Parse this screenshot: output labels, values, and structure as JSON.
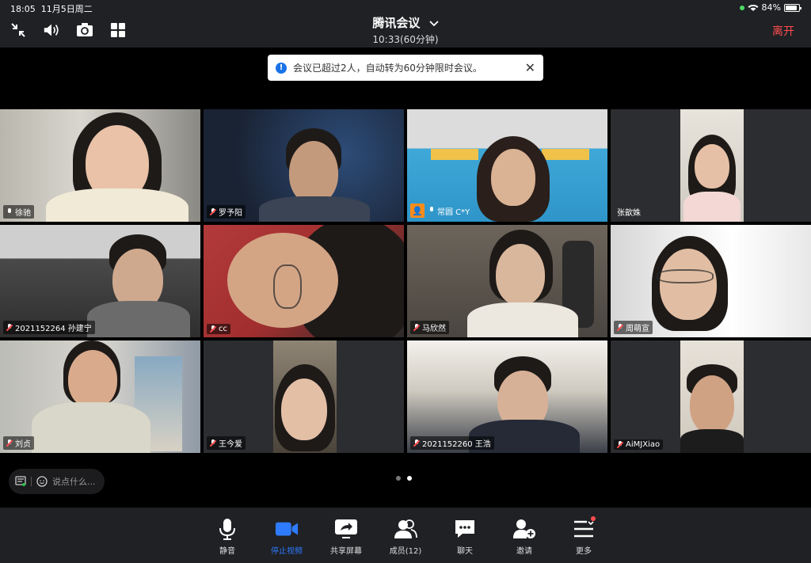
{
  "status": {
    "time": "18:05",
    "date": "11月5日周二",
    "battery": "84%"
  },
  "header": {
    "title": "腾讯会议",
    "duration": "10:33(60分钟)",
    "leave_label": "离开"
  },
  "toast": {
    "message": "会议已超过2人，自动转为60分钟限时会议。",
    "icon": "info-icon"
  },
  "participants": [
    {
      "name": "徐驰",
      "mic": "on",
      "active": true
    },
    {
      "name": "罗予阳",
      "mic": "muted"
    },
    {
      "name": "常圆 C*Y",
      "mic": "on",
      "host": true
    },
    {
      "name": "张歆姝",
      "mic": "none"
    },
    {
      "name": "2021152264 孙建宁",
      "mic": "muted"
    },
    {
      "name": "cc",
      "mic": "muted"
    },
    {
      "name": "马欣然",
      "mic": "muted"
    },
    {
      "name": "周萌宣",
      "mic": "muted"
    },
    {
      "name": "刘贞",
      "mic": "muted"
    },
    {
      "name": "王今爱",
      "mic": "muted"
    },
    {
      "name": "2021152260 王浩",
      "mic": "muted"
    },
    {
      "name": "AiMJXiao",
      "mic": "muted"
    }
  ],
  "chat": {
    "placeholder": "说点什么..."
  },
  "toolbar": {
    "mute": "静音",
    "stop_video": "停止视频",
    "share_screen": "共享屏幕",
    "members": "成员(12)",
    "chat": "聊天",
    "invite": "邀请",
    "more": "更多"
  },
  "colors": {
    "accent": "#2f7bff",
    "leave": "#ff4d4f",
    "active_border": "#29c24a"
  }
}
